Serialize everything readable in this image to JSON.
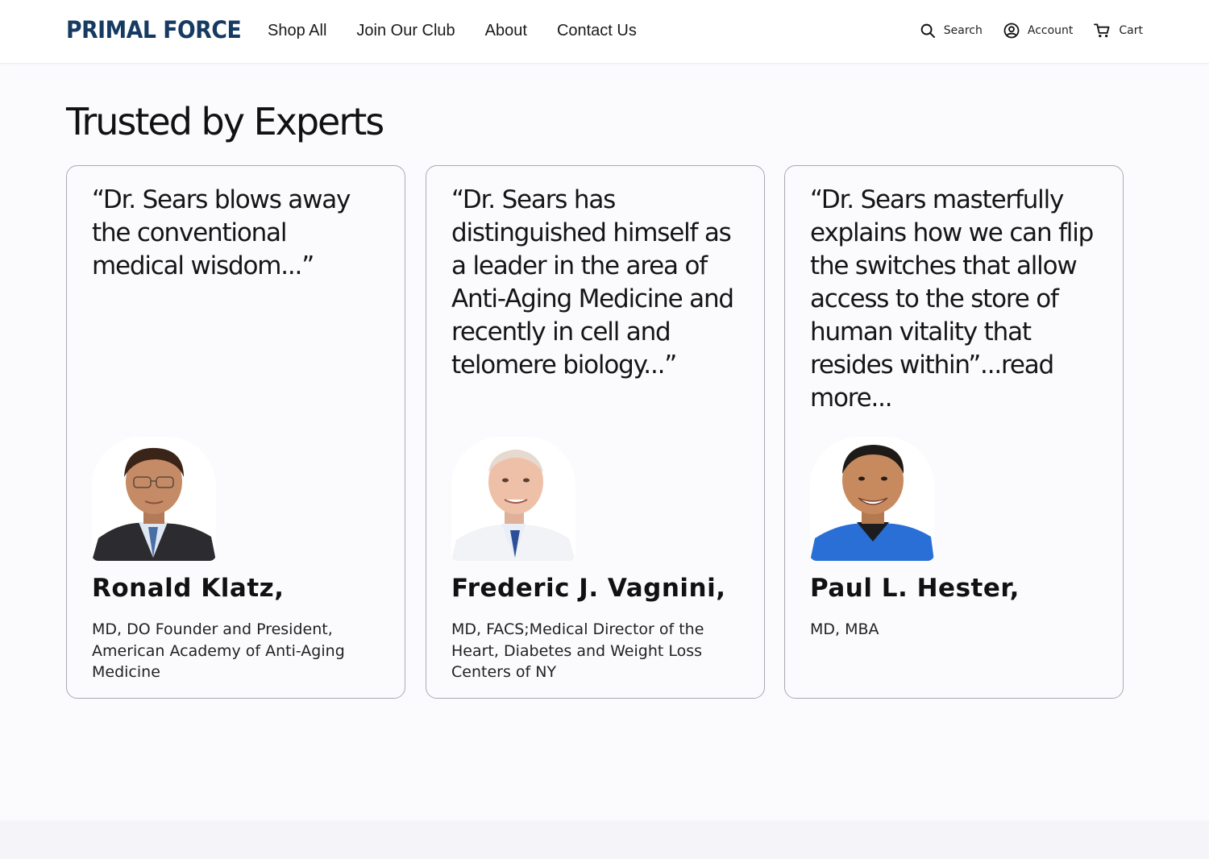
{
  "brand": {
    "logo": "PRIMAL FORCE",
    "color": "#163a62"
  },
  "nav": {
    "items": [
      "Shop All",
      "Join Our Club",
      "About",
      "Contact Us"
    ]
  },
  "utils": {
    "search": {
      "label": "Search",
      "icon": "search-icon"
    },
    "account": {
      "label": "Account",
      "icon": "account-icon"
    },
    "cart": {
      "label": "Cart",
      "icon": "cart-icon"
    }
  },
  "section": {
    "title": "Trusted by Experts",
    "cards": [
      {
        "quote": "“Dr. Sears blows away the conventional medical wisdom...”",
        "name": "Ronald Klatz,",
        "credentials": "MD, DO Founder and President, American Academy of Anti-Aging Medicine",
        "photo": "portrait-suit"
      },
      {
        "quote": "“Dr. Sears has distinguished himself as a leader in the area of Anti-Aging Medicine and recently in cell and telomere biology...”",
        "name": "Frederic J. Vagnini,",
        "credentials": "MD, FACS;Medical Director of the Heart, Diabetes and Weight Loss Centers of NY",
        "photo": "portrait-white-coat"
      },
      {
        "quote": "“Dr. Sears masterfully explains how we can flip the switches that allow access to the store of human vitality that resides within”...read more...",
        "name": "Paul L. Hester,",
        "credentials": "MD, MBA",
        "photo": "portrait-blue-scrubs"
      }
    ]
  },
  "colors": {
    "card_border": "#a9a9b2",
    "background": "#fbfbfe",
    "text": "#111111"
  }
}
